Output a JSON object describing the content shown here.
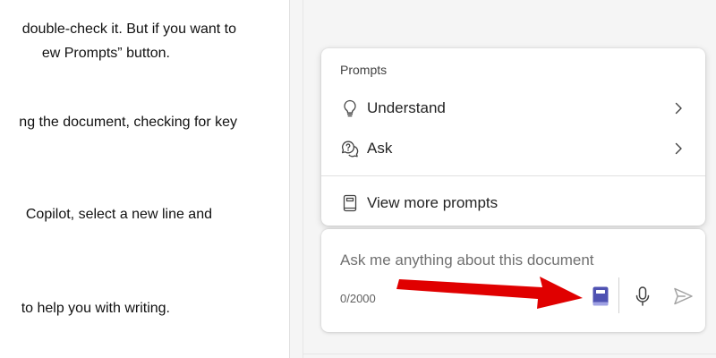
{
  "document": {
    "lines": [
      "double-check it. But if you want to",
      "ew Prompts” button.",
      "ng the document, checking for key",
      "Copilot, select a new line and",
      "to help you with writing."
    ]
  },
  "prompts_menu": {
    "header": "Prompts",
    "items": [
      {
        "label": "Understand",
        "icon": "lightbulb-icon"
      },
      {
        "label": "Ask",
        "icon": "chat-question-icon"
      },
      {
        "label": "View more prompts",
        "icon": "book-icon"
      }
    ]
  },
  "composer": {
    "placeholder": "Ask me anything about this document",
    "char_count": "0/2000",
    "buttons": [
      "prompts-book-icon",
      "microphone-icon",
      "send-icon"
    ]
  },
  "colors": {
    "accent": "#4f52b2",
    "annotation_arrow": "#e00000",
    "pane_background": "#f5f5f5"
  }
}
